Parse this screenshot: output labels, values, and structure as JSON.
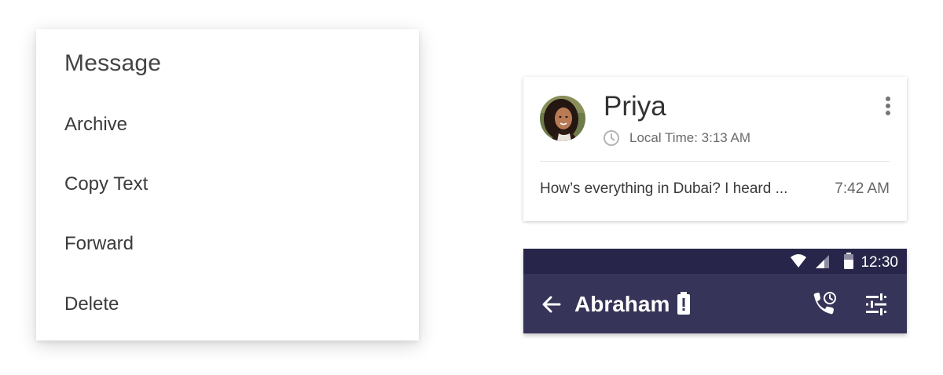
{
  "menu": {
    "title": "Message",
    "items": [
      {
        "label": "Archive"
      },
      {
        "label": "Copy Text"
      },
      {
        "label": "Forward"
      },
      {
        "label": "Delete"
      }
    ]
  },
  "contact_card": {
    "name": "Priya",
    "avatar_icon": "profile-photo",
    "local_time": "Local Time: 3:13 AM",
    "clock_icon": "clock-icon",
    "more_icon": "more-vertical-icon",
    "last_message": {
      "preview": "How’s everything in Dubai? I heard ...",
      "time": "7:42 AM"
    }
  },
  "phone": {
    "status_bar": {
      "time": "12:30",
      "icons": [
        "wifi-icon",
        "signal-icon",
        "battery-icon"
      ]
    },
    "app_bar": {
      "title": "Abraham",
      "back_icon": "arrow-back-icon",
      "title_badge_icon": "battery-alert-icon",
      "actions": [
        "scheduled-call-icon",
        "tune-icon"
      ]
    }
  },
  "colors": {
    "status_bar": "#27264a",
    "app_bar": "#363458",
    "app_bar_text": "#ffffff",
    "menu_text": "#3a3a3a"
  }
}
